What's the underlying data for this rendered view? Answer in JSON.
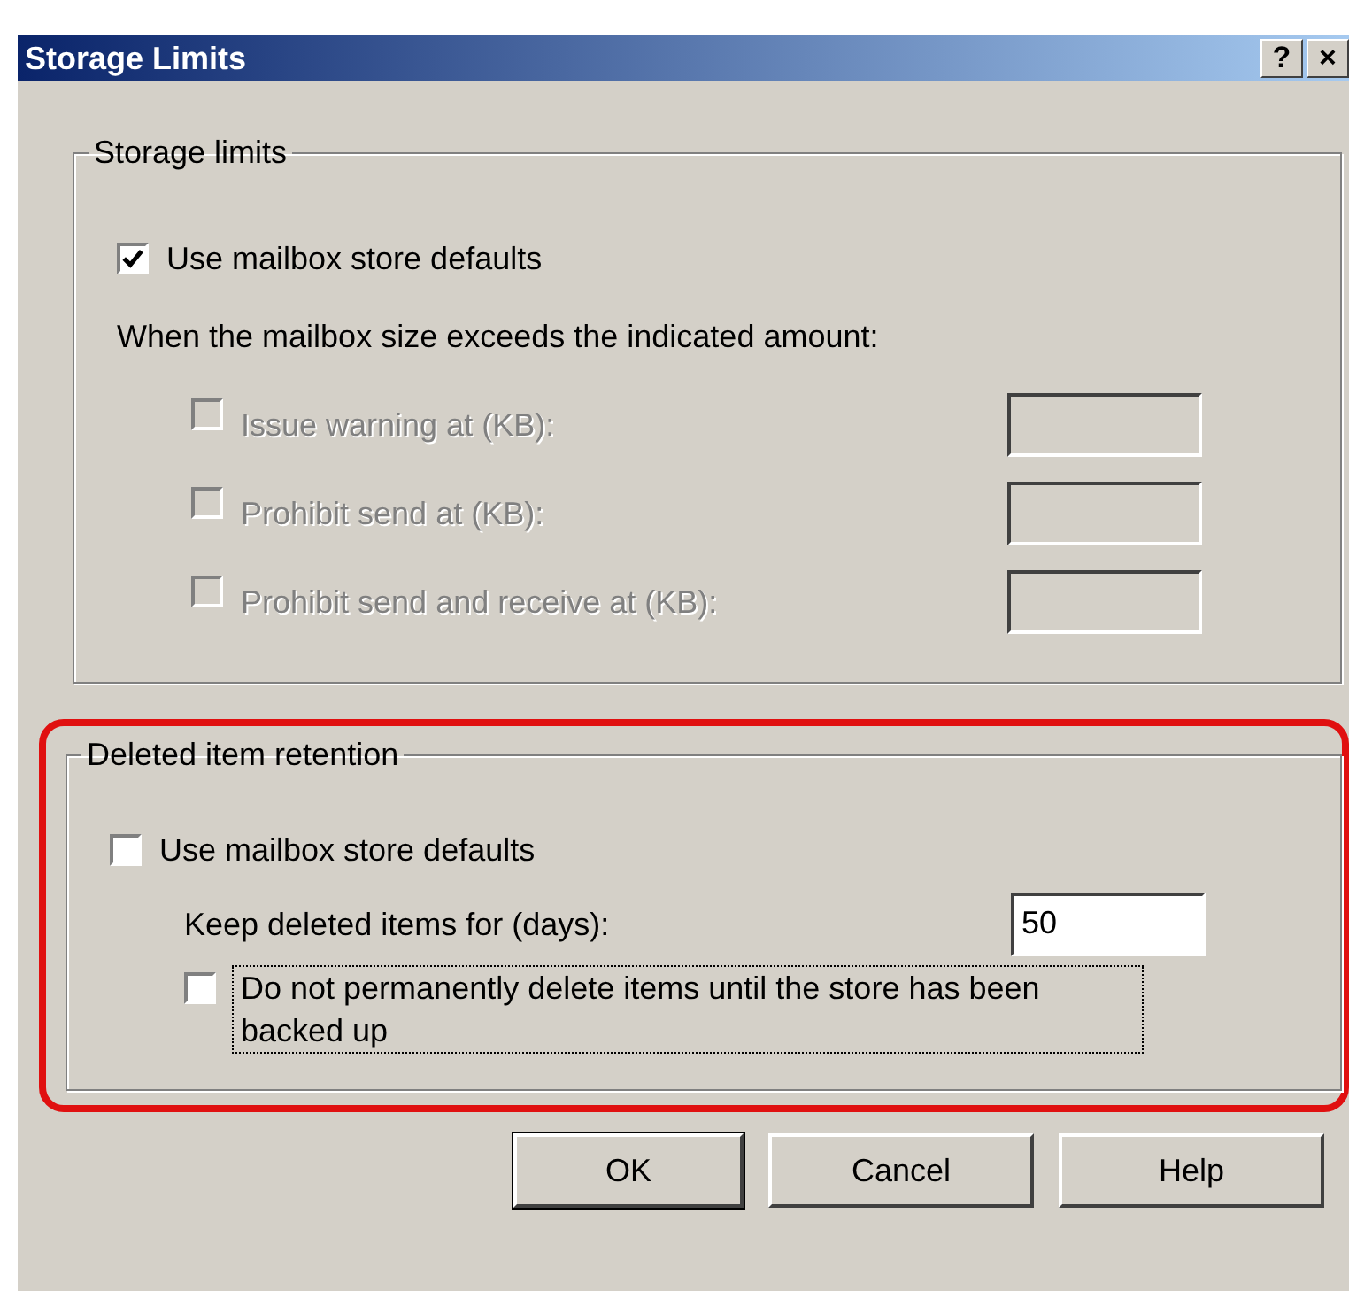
{
  "window": {
    "title": "Storage Limits",
    "buttons": [
      "?",
      "×"
    ]
  },
  "groups": [
    {
      "label": "Storage limits",
      "highlighted": false,
      "items": [
        {
          "kind": "checkbox",
          "label": "Use mailbox store defaults",
          "checked": true,
          "disabled": false,
          "focused": false
        },
        {
          "kind": "text",
          "label": "When the mailbox size exceeds the indicated amount:",
          "children": [
            {
              "kind": "limit",
              "label": "Issue warning at (KB):",
              "checked": false,
              "disabled": true
            },
            {
              "kind": "limit",
              "label": "Prohibit send at (KB):",
              "checked": false,
              "disabled": true
            },
            {
              "kind": "limit",
              "label": "Prohibit send and receive at (KB):",
              "checked": false,
              "disabled": true
            }
          ]
        }
      ]
    },
    {
      "label": "Deleted item retention",
      "highlighted": true,
      "items": [
        {
          "kind": "checkbox",
          "label": "Use mailbox store defaults",
          "checked": false,
          "disabled": false,
          "focused": false,
          "children": [
            {
              "kind": "field",
              "label": "Keep deleted items for (days):",
              "value": "50",
              "disabled": false
            },
            {
              "kind": "checkbox",
              "label": "Do not permanently delete items until the store has been backed up",
              "checked": false,
              "disabled": false,
              "focused": true
            }
          ]
        }
      ]
    }
  ],
  "buttons": [
    {
      "label": "OK",
      "default": true
    },
    {
      "label": "Cancel",
      "default": false
    },
    {
      "label": "Help",
      "default": false
    }
  ]
}
